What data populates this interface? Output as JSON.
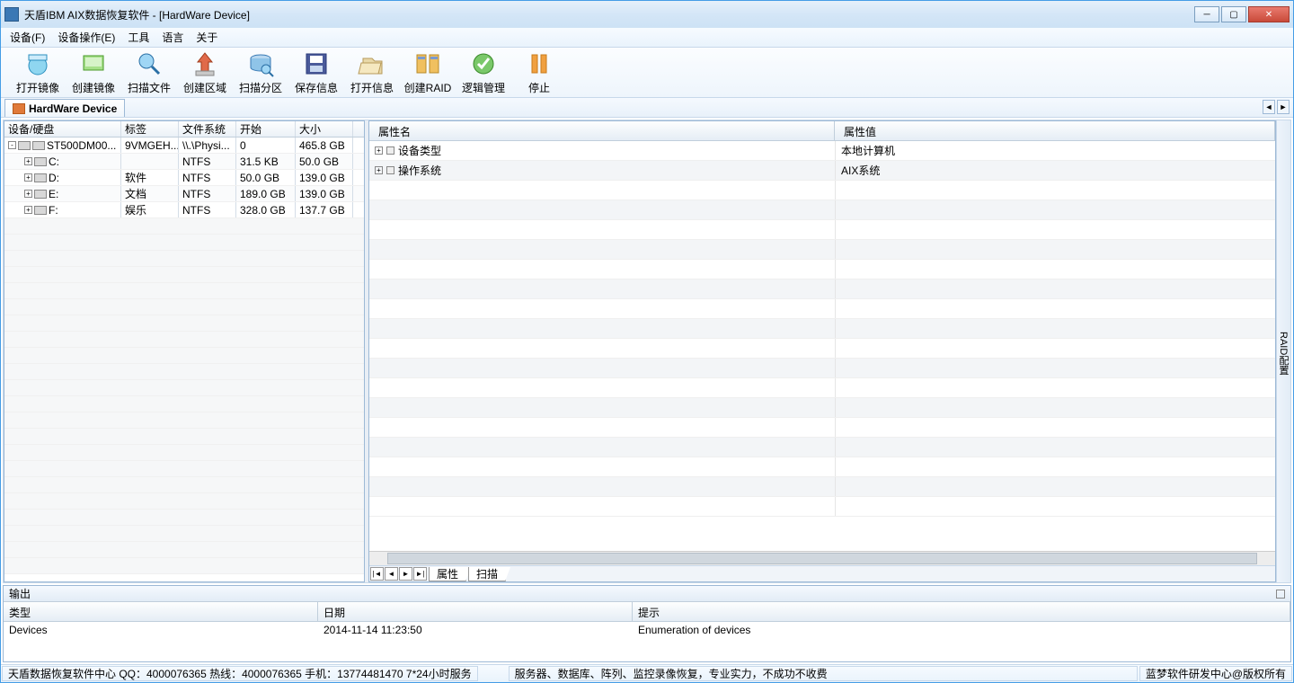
{
  "window": {
    "title": "天盾IBM AIX数据恢复软件 - [HardWare Device]"
  },
  "menu": {
    "device_f": "设备(F)",
    "device_ops_e": "设备操作(E)",
    "tools": "工具",
    "language": "语言",
    "about": "关于"
  },
  "toolbar": {
    "open_image": "打开镜像",
    "create_image": "创建镜像",
    "scan_files": "扫描文件",
    "create_region": "创建区域",
    "scan_partition": "扫描分区",
    "save_info": "保存信息",
    "open_info": "打开信息",
    "create_raid": "创建RAID",
    "logical_mgmt": "逻辑管理",
    "stop": "停止"
  },
  "tabs": {
    "hardware_device": "HardWare Device"
  },
  "left_grid": {
    "headers": {
      "device": "设备/硬盘",
      "label": "标签",
      "filesystem": "文件系统",
      "start": "开始",
      "size": "大小"
    },
    "rows": [
      {
        "device": "ST500DM00...",
        "label": "9VMGEH...",
        "filesystem": "\\\\.\\Physi...",
        "start": "0",
        "size": "465.8 GB",
        "indent": 0,
        "expander": "-",
        "icons": 2
      },
      {
        "device": "C:",
        "label": "",
        "filesystem": "NTFS",
        "start": "31.5 KB",
        "size": "50.0 GB",
        "indent": 1,
        "expander": "+",
        "icons": 1
      },
      {
        "device": "D:",
        "label": "软件",
        "filesystem": "NTFS",
        "start": "50.0 GB",
        "size": "139.0 GB",
        "indent": 1,
        "expander": "+",
        "icons": 1
      },
      {
        "device": "E:",
        "label": "文档",
        "filesystem": "NTFS",
        "start": "189.0 GB",
        "size": "139.0 GB",
        "indent": 1,
        "expander": "+",
        "icons": 1
      },
      {
        "device": "F:",
        "label": "娱乐",
        "filesystem": "NTFS",
        "start": "328.0 GB",
        "size": "137.7 GB",
        "indent": 1,
        "expander": "+",
        "icons": 1
      }
    ]
  },
  "props": {
    "header_name": "属性名",
    "header_value": "属性值",
    "rows": [
      {
        "name": "设备类型",
        "value": "本地计算机",
        "exp": "+"
      },
      {
        "name": "操作系统",
        "value": "AIX系统",
        "exp": "+"
      }
    ],
    "tabs": {
      "properties": "属性",
      "scan": "扫描"
    }
  },
  "side_rail": "RAID配置",
  "output": {
    "title": "输出",
    "headers": {
      "type": "类型",
      "date": "日期",
      "hint": "提示"
    },
    "rows": [
      {
        "type": "Devices",
        "date": "2014-11-14 11:23:50",
        "hint": "Enumeration of devices"
      }
    ]
  },
  "status": {
    "left": "天盾数据恢复软件中心 QQ：4000076365 热线：4000076365 手机：13774481470  7*24小时服务",
    "center": "服务器、数据库、阵列、监控录像恢复，专业实力，不成功不收费",
    "right": "蓝梦软件研发中心@版权所有"
  }
}
